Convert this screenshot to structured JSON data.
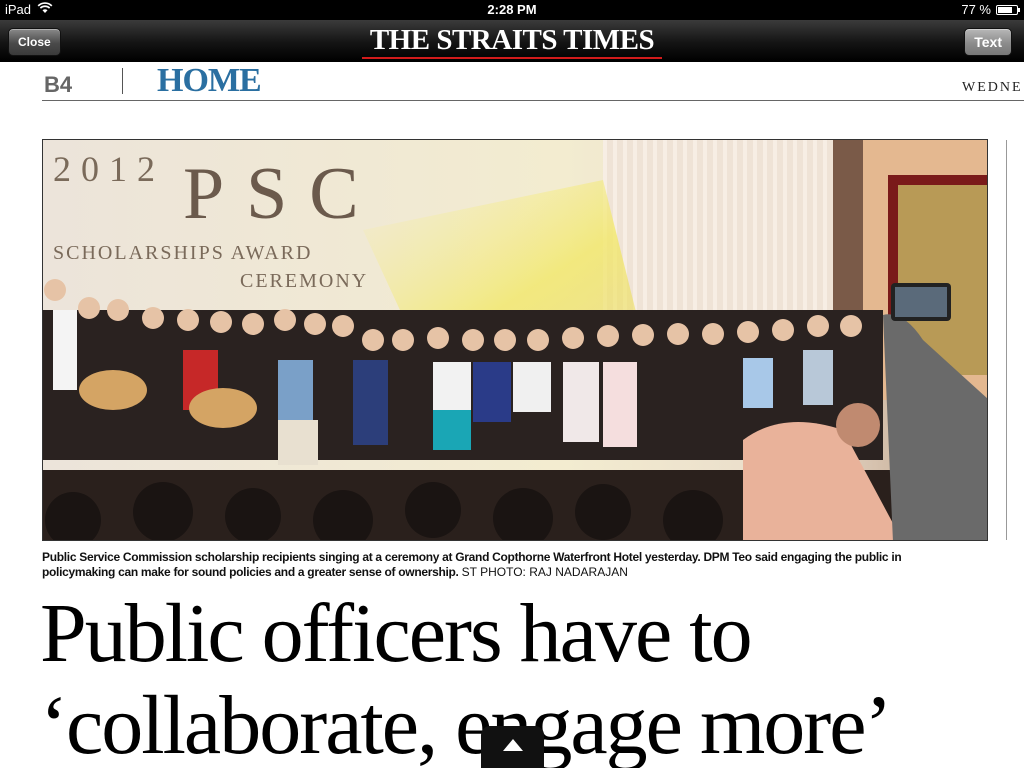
{
  "status_bar": {
    "device": "iPad",
    "time": "2:28 PM",
    "battery": "77 %",
    "battery_level": 0.77
  },
  "toolbar": {
    "close_label": "Close",
    "masthead": "THE STRAITS TIMES",
    "text_label": "Text"
  },
  "page_header": {
    "page_number": "B4",
    "section": "HOME",
    "dateline": "WEDNE"
  },
  "photo": {
    "backdrop_year": "2012",
    "backdrop_title": "PSC",
    "backdrop_line1": "SCHOLARSHIPS AWARD",
    "backdrop_line2": "CEREMONY"
  },
  "caption": {
    "text": "Public Service Commission scholarship recipients singing at a ceremony at Grand Copthorne Waterfront Hotel yesterday. DPM Teo said engaging the public in policymaking can make for sound policies and a greater sense of ownership.",
    "credit": "ST PHOTO: RAJ NADARAJAN"
  },
  "headline": {
    "line1": "Public officers have to",
    "line2": "‘collaborate, engage more’"
  },
  "colors": {
    "section_blue": "#2a6fa1",
    "masthead_underline": "#d21b1b"
  },
  "icons": {
    "wifi": "wifi-icon",
    "battery": "battery-icon",
    "drawer_handle": "chevron-up-icon"
  }
}
